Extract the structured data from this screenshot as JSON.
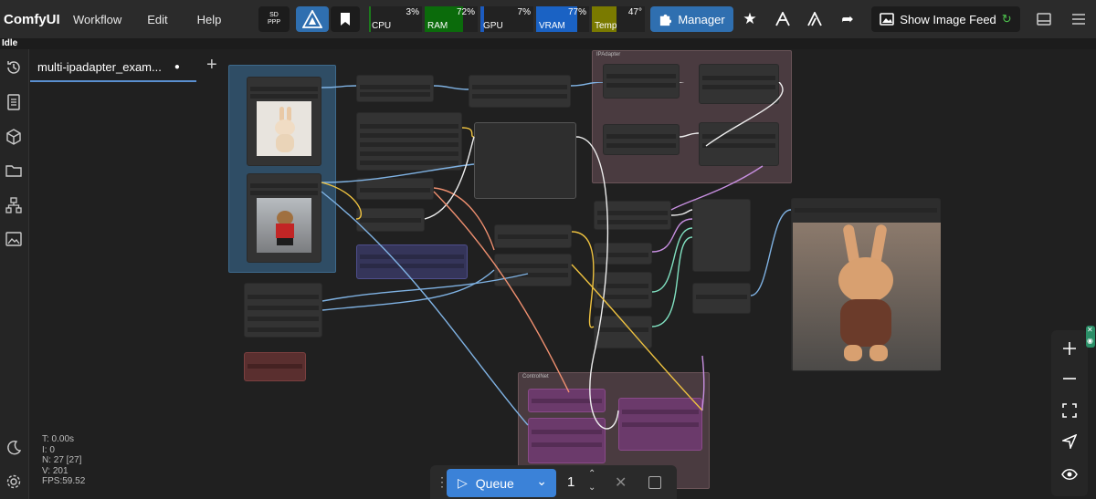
{
  "app": {
    "title": "ComfyUI"
  },
  "menu": {
    "workflow": "Workflow",
    "edit": "Edit",
    "help": "Help"
  },
  "toolbar": {
    "sd_badge_line1": "SD",
    "sd_badge_line2": "PPP",
    "manager_label": "Manager",
    "image_feed_label": "Show Image Feed"
  },
  "monitors": [
    {
      "label": "CPU",
      "value": "3%",
      "percent": 3,
      "color": "#1c7a1c"
    },
    {
      "label": "RAM",
      "value": "72%",
      "percent": 72,
      "color": "#0b6b0b"
    },
    {
      "label": "GPU",
      "value": "7%",
      "percent": 7,
      "color": "#1c5bbf"
    },
    {
      "label": "VRAM",
      "value": "77%",
      "percent": 77,
      "color": "#1a62c4"
    },
    {
      "label": "Temp",
      "value": "47°",
      "percent": 47,
      "color": "#7a7a00"
    }
  ],
  "status": {
    "text": "Idle"
  },
  "tabs": [
    {
      "label": "multi-ipadapter_exam...",
      "unsaved_dot": "●"
    }
  ],
  "new_tab_label": "+",
  "stats": {
    "t": "T: 0.00s",
    "i": "I: 0",
    "n": "N: 27 [27]",
    "v": "V: 201",
    "fps": "FPS:59.52"
  },
  "queue": {
    "label": "Queue",
    "count": "1"
  },
  "groups": {
    "ipadapter": "IPAdapter",
    "controlnet": "ControlNet"
  },
  "colors": {
    "accent": "#2f6fb0",
    "topbar": "#2b2b2b",
    "canvas": "#202020"
  }
}
